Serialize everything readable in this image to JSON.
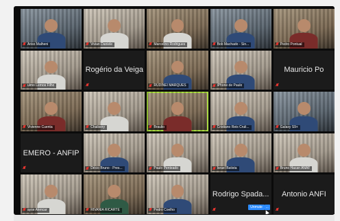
{
  "meeting": {
    "tiles": [
      {
        "name": "Ariso Malheni",
        "kind": "video",
        "tone": "cool",
        "shirt": "blue"
      },
      {
        "name": "Vivian Daniele",
        "kind": "video",
        "tone": "light",
        "shirt": "white"
      },
      {
        "name": "Marcelino Rodrigues",
        "kind": "video",
        "tone": "warm",
        "shirt": "white"
      },
      {
        "name": "Bob Machado - Sin...",
        "kind": "video",
        "tone": "cool",
        "shirt": "blue"
      },
      {
        "name": "Pedro Pontual",
        "kind": "video",
        "tone": "warm",
        "shirt": "red"
      },
      {
        "name": "ulmo Lemos Filho",
        "kind": "video",
        "tone": "light",
        "shirt": "white"
      },
      {
        "name": "Rogério da Veiga",
        "kind": "name-only"
      },
      {
        "name": "RUDINEI MARQUES",
        "kind": "video",
        "tone": "warm",
        "shirt": "blue"
      },
      {
        "name": "iPhone de Paulo",
        "kind": "video",
        "tone": "light",
        "shirt": "blue"
      },
      {
        "name": "Mauricio Po",
        "kind": "name-only"
      },
      {
        "name": "Vivienne Cuenta",
        "kind": "video",
        "tone": "warm",
        "shirt": "red"
      },
      {
        "name": "Chalisery",
        "kind": "video",
        "tone": "light",
        "shirt": "white"
      },
      {
        "name": "Braulio",
        "kind": "video",
        "tone": "warm",
        "shirt": "red",
        "active": true
      },
      {
        "name": "Cristiano Reis Cruli...",
        "kind": "video",
        "tone": "light",
        "shirt": "blue"
      },
      {
        "name": "Galaxy S9+",
        "kind": "video",
        "tone": "cool",
        "shirt": "blue"
      },
      {
        "name": "EMERO - ANFIP",
        "kind": "name-only"
      },
      {
        "name": "Décio Bruno - Pres...",
        "kind": "video",
        "tone": "light",
        "shirt": "blue"
      },
      {
        "name": "Paulo Penteado",
        "kind": "video",
        "tone": "light",
        "shirt": "white"
      },
      {
        "name": "Israel Batista",
        "kind": "video",
        "tone": "light",
        "shirt": "blue"
      },
      {
        "name": "Bruno Hacan ANAF",
        "kind": "video",
        "tone": "light",
        "shirt": "white"
      },
      {
        "name": "ayse Alencar",
        "kind": "video",
        "tone": "light",
        "shirt": "white"
      },
      {
        "name": "RIVANIA RICARTE",
        "kind": "video",
        "tone": "warm",
        "shirt": "green"
      },
      {
        "name": "Pedro Coelho",
        "kind": "video",
        "tone": "light",
        "shirt": "blue"
      },
      {
        "name": "Rodrigo Spada...",
        "kind": "name-only",
        "unmute": "Unmute",
        "more": "..."
      },
      {
        "name": "Antonio ANFI",
        "kind": "name-only"
      }
    ]
  }
}
